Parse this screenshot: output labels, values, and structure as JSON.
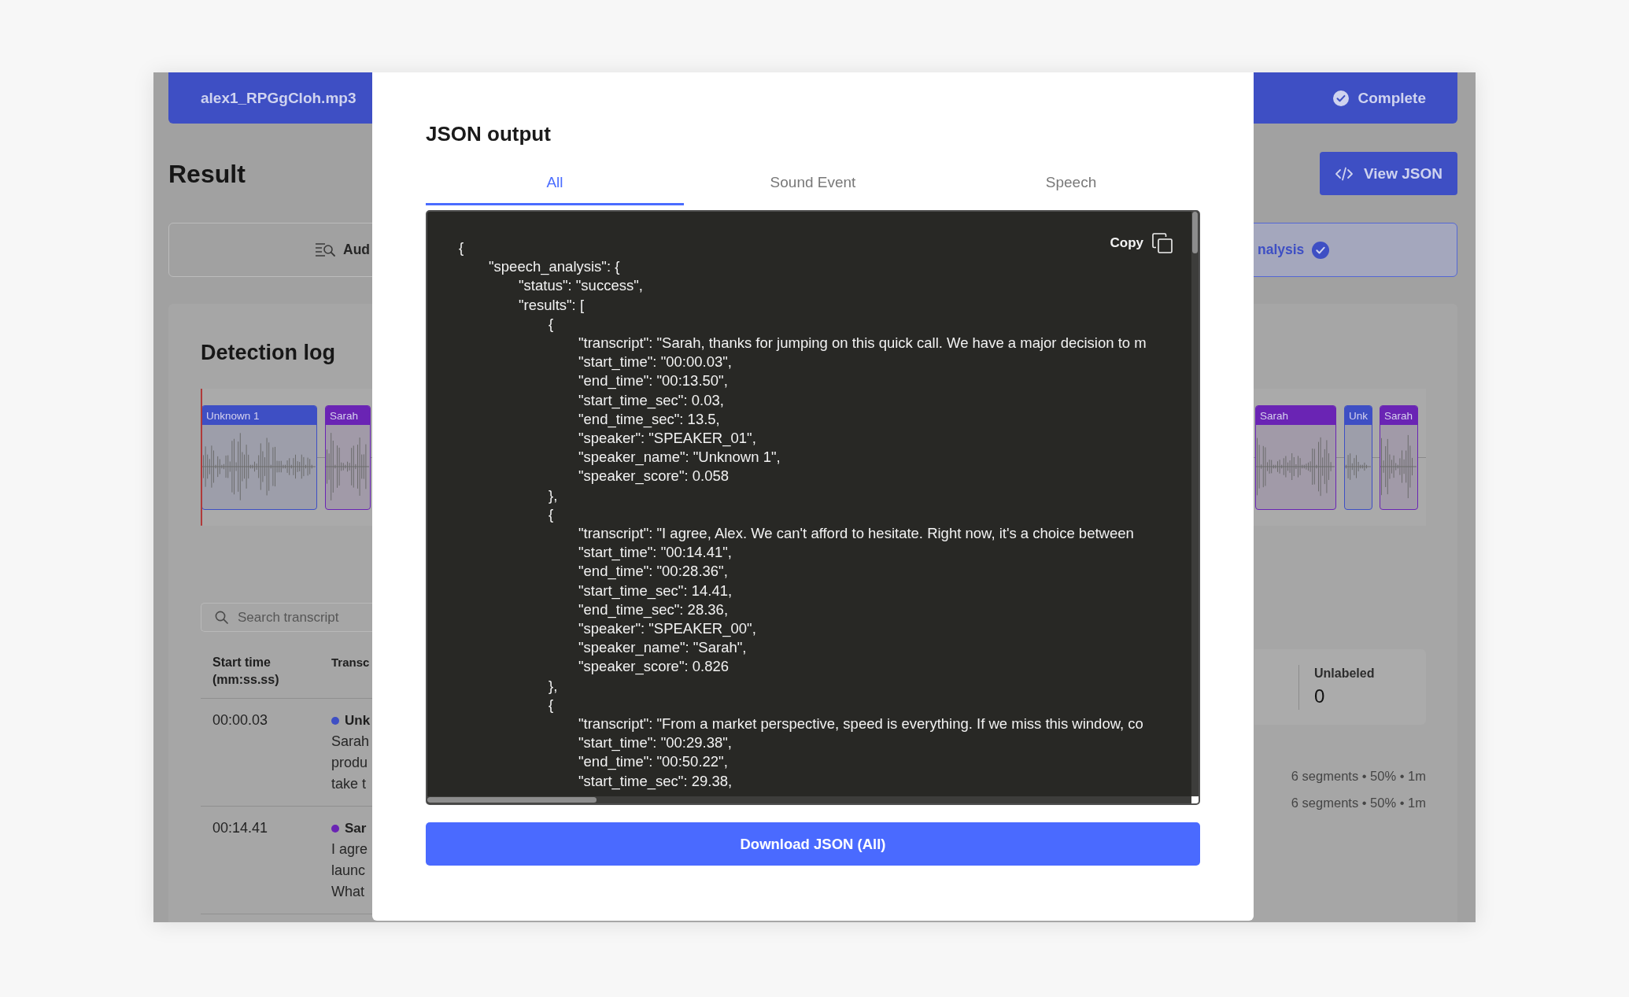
{
  "background": {
    "file_bar": {
      "filename": "alex1_RPGgCloh.mp3",
      "status": "Complete"
    },
    "heading": "Result",
    "view_json_button": "View JSON",
    "tabs": [
      {
        "label": "Aud",
        "kind": "search",
        "selected": false
      },
      {
        "label": "nalysis",
        "kind": "verified",
        "selected": true
      }
    ],
    "detection_log": {
      "title": "Detection log",
      "segments": [
        {
          "label": "Unknown 1",
          "color": "#3e4fc4"
        },
        {
          "label": "Sarah",
          "color": "#6a24b4"
        },
        {
          "label": "Sarah",
          "color": "#6a24b4"
        },
        {
          "label": "Unk",
          "color": "#3e4fc4"
        },
        {
          "label": "Sarah",
          "color": "#6a24b4"
        }
      ]
    },
    "search": {
      "placeholder": "Search transcript"
    },
    "table": {
      "columns": [
        "Start time (mm:ss.ss)",
        "Transc"
      ],
      "rows": [
        {
          "start_time": "00:00.03",
          "speaker": "Unk",
          "color": "#3e4fc4",
          "transcript_lines": [
            "Sarah",
            "produ",
            "take t"
          ]
        },
        {
          "start_time": "00:14.41",
          "speaker": "Sar",
          "color": "#6a24b4",
          "transcript_lines": [
            "I agre",
            "launc",
            "What"
          ]
        }
      ]
    },
    "stats": [
      {
        "label": "Unlabeled",
        "value": "0"
      }
    ],
    "segment_summaries": [
      "6 segments • 50% • 1m",
      "6 segments • 50% • 1m"
    ]
  },
  "modal": {
    "title": "JSON output",
    "tabs": [
      {
        "label": "All",
        "selected": true
      },
      {
        "label": "Sound Event",
        "selected": false
      },
      {
        "label": "Speech",
        "selected": false
      }
    ],
    "copy_button": "Copy",
    "code": [
      {
        "text": "{",
        "children": [
          {
            "text": "\"speech_analysis\": {",
            "children": [
              {
                "text": "\"status\": \"success\","
              },
              {
                "text": "\"results\": [",
                "children": [
                  {
                    "text": "{",
                    "children": [
                      {
                        "text": "\"transcript\": \"Sarah, thanks for jumping on this quick call. We have a major decision to m"
                      },
                      {
                        "text": "\"start_time\": \"00:00.03\","
                      },
                      {
                        "text": "\"end_time\": \"00:13.50\","
                      },
                      {
                        "text": "\"start_time_sec\": 0.03,"
                      },
                      {
                        "text": "\"end_time_sec\": 13.5,"
                      },
                      {
                        "text": "\"speaker\": \"SPEAKER_01\","
                      },
                      {
                        "text": "\"speaker_name\": \"Unknown 1\","
                      },
                      {
                        "text": "\"speaker_score\": 0.058"
                      }
                    ]
                  },
                  {
                    "text": "},"
                  },
                  {
                    "text": "{",
                    "children": [
                      {
                        "text": "\"transcript\": \"I agree, Alex. We can't afford to hesitate. Right now, it's a choice between"
                      },
                      {
                        "text": "\"start_time\": \"00:14.41\","
                      },
                      {
                        "text": "\"end_time\": \"00:28.36\","
                      },
                      {
                        "text": "\"start_time_sec\": 14.41,"
                      },
                      {
                        "text": "\"end_time_sec\": 28.36,"
                      },
                      {
                        "text": "\"speaker\": \"SPEAKER_00\","
                      },
                      {
                        "text": "\"speaker_name\": \"Sarah\","
                      },
                      {
                        "text": "\"speaker_score\": 0.826"
                      }
                    ]
                  },
                  {
                    "text": "},"
                  },
                  {
                    "text": "{",
                    "children": [
                      {
                        "text": "\"transcript\": \"From a market perspective, speed is everything. If we miss this window, co"
                      },
                      {
                        "text": "\"start_time\": \"00:29.38\","
                      },
                      {
                        "text": "\"end_time\": \"00:50.22\","
                      },
                      {
                        "text": "\"start_time_sec\": 29.38,"
                      }
                    ]
                  }
                ]
              }
            ]
          }
        ]
      }
    ],
    "download_button": "Download JSON (All)"
  }
}
